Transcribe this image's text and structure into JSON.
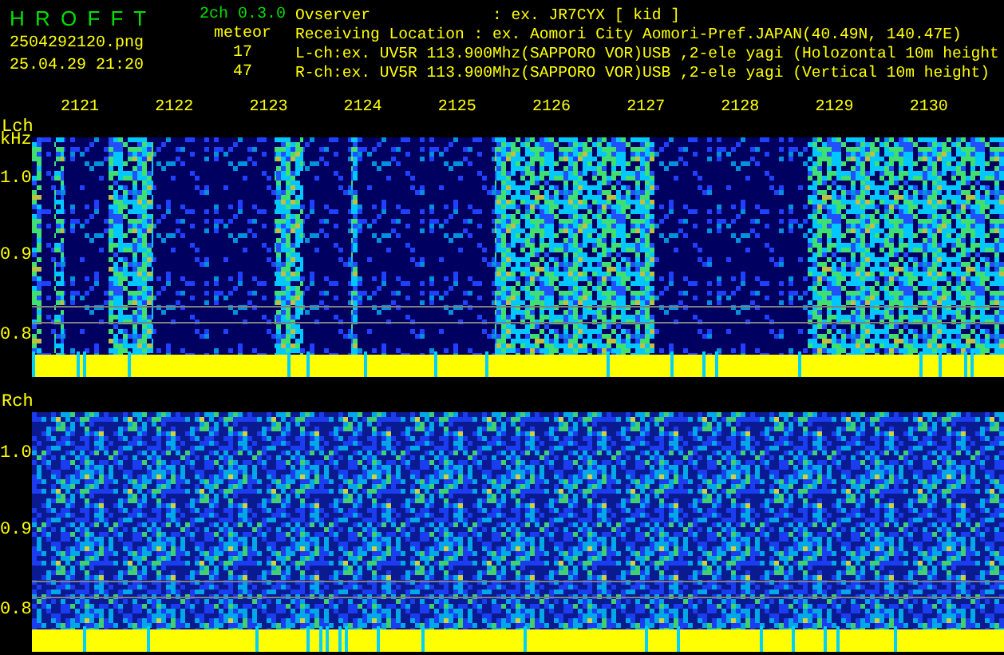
{
  "app": {
    "title": "H R O F F T",
    "version": "2ch 0.3.0",
    "filename": "2504292120.png",
    "datetime": "25.04.29 21:20",
    "meteor_label": "meteor"
  },
  "info_lines": [
    "Ovserver             : ex. JR7CYX [ kid ]",
    "Receiving Location : ex. Aomori City Aomori-Pref.JAPAN(40.49N, 140.47E)",
    "L-ch:ex. UV5R 113.900Mhz(SAPPORO VOR)USB ,2-ele yagi (Holozontal 10m height",
    "R-ch:ex. UV5R 113.900Mhz(SAPPORO VOR)USB ,2-ele yagi (Vertical 10m height)"
  ],
  "channels": [
    {
      "label": "Lch",
      "unit": "kHz",
      "count": "17",
      "y_ticks": [
        "1.0",
        "0.9",
        "0.8"
      ],
      "time_labels": [
        "2121",
        "2122",
        "2123",
        "2124",
        "2125",
        "2126",
        "2127",
        "2128",
        "2129",
        "2130"
      ]
    },
    {
      "label": "Rch",
      "count": "47",
      "y_ticks": [
        "1.0",
        "0.9",
        "0.8"
      ]
    }
  ]
}
